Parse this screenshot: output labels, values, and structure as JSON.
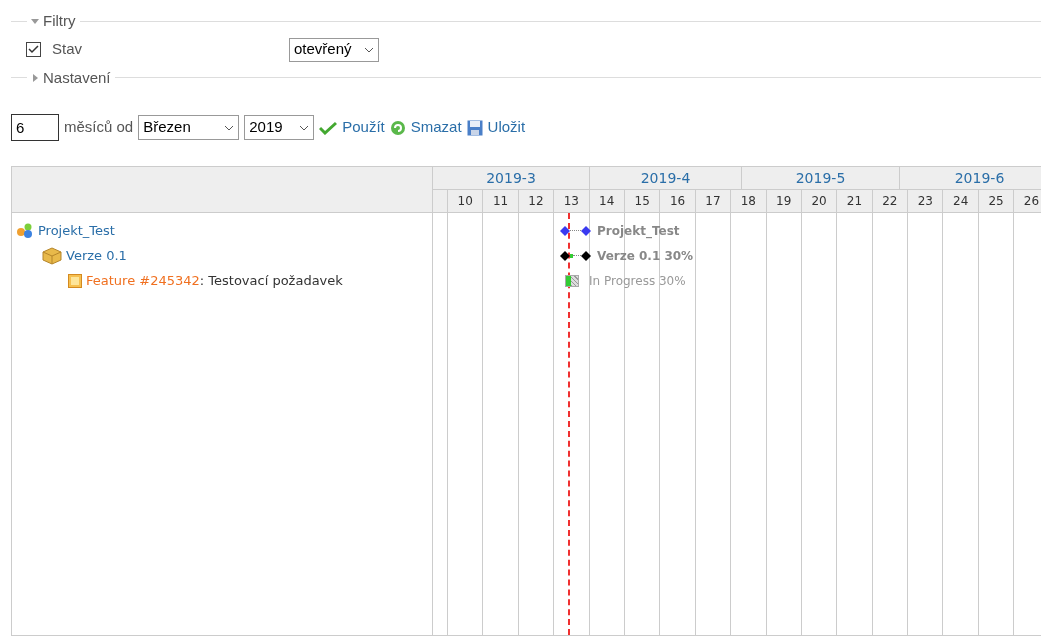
{
  "filters": {
    "legend": "Filtry",
    "expanded": true,
    "status": {
      "label": "Stav",
      "checked": true,
      "value": "otevřený"
    }
  },
  "settings": {
    "legend": "Nastavení",
    "expanded": false
  },
  "range": {
    "months": "6",
    "label": "měsíců od",
    "month": "Březen",
    "year": "2019",
    "actions": [
      {
        "kind": "apply",
        "label": "Použít"
      },
      {
        "kind": "clear",
        "label": "Smazat"
      },
      {
        "kind": "save",
        "label": "Uložit"
      }
    ]
  },
  "gantt": {
    "months": [
      "2019-3",
      "2019-4",
      "2019-5",
      "2019-6"
    ],
    "weeks": [
      "10",
      "11",
      "12",
      "13",
      "14",
      "15",
      "16",
      "17",
      "18",
      "19",
      "20",
      "21",
      "22",
      "23",
      "24",
      "25",
      "26"
    ],
    "tree": [
      {
        "kind": "project",
        "label": "Projekt_Test",
        "children": [
          {
            "kind": "version",
            "label": "Verze 0.1",
            "children": [
              {
                "kind": "issue",
                "link": "Feature #245342",
                "subject": ": Testovací požadavek"
              }
            ]
          }
        ]
      }
    ],
    "bars": [
      {
        "kind": "project",
        "label": "Projekt_Test"
      },
      {
        "kind": "version",
        "label": "Verze 0.1 30%"
      },
      {
        "kind": "issue",
        "label": "In Progress 30%"
      }
    ]
  }
}
